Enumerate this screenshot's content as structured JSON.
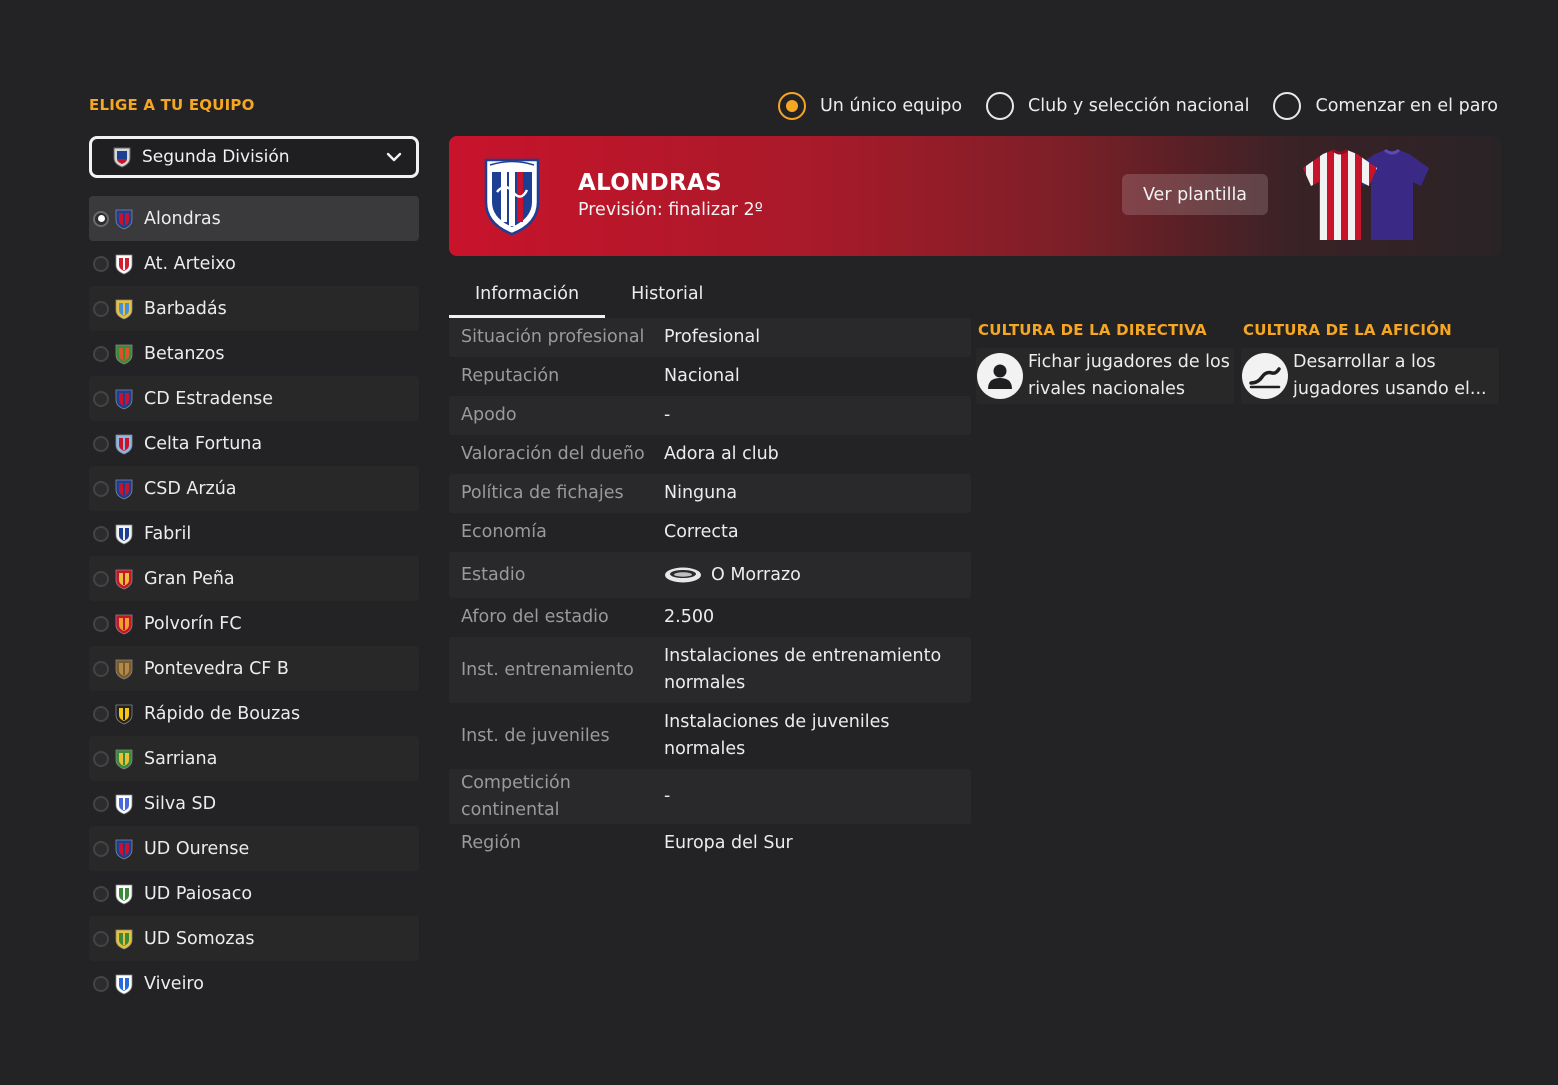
{
  "header": {
    "choose_team_title": "ELIGE A TU EQUIPO"
  },
  "division_select": {
    "value": "Segunda División"
  },
  "mode_options": [
    {
      "label": "Un único equipo",
      "selected": true
    },
    {
      "label": "Club y selección nacional",
      "selected": false
    },
    {
      "label": "Comenzar en el paro",
      "selected": false
    }
  ],
  "teams": [
    {
      "name": "Alondras",
      "selected": true,
      "colors": [
        "#c8132b",
        "#1c3f94"
      ]
    },
    {
      "name": "At. Arteixo",
      "selected": false,
      "colors": [
        "#d11f2e",
        "#ffffff"
      ]
    },
    {
      "name": "Barbadás",
      "selected": false,
      "colors": [
        "#4a90d9",
        "#e8c13a"
      ]
    },
    {
      "name": "Betanzos",
      "selected": false,
      "colors": [
        "#d9532b",
        "#3a8a3a"
      ]
    },
    {
      "name": "CD Estradense",
      "selected": false,
      "colors": [
        "#c8132b",
        "#1c3f94"
      ]
    },
    {
      "name": "Celta Fortuna",
      "selected": false,
      "colors": [
        "#c8132b",
        "#8ab8e0"
      ]
    },
    {
      "name": "CSD Arzúa",
      "selected": false,
      "colors": [
        "#c8132b",
        "#1c3f94"
      ]
    },
    {
      "name": "Fabril",
      "selected": false,
      "colors": [
        "#1c3f94",
        "#f2f2f2"
      ]
    },
    {
      "name": "Gran Peña",
      "selected": false,
      "colors": [
        "#e8c13a",
        "#c8132b"
      ]
    },
    {
      "name": "Polvorín FC",
      "selected": false,
      "colors": [
        "#f0a030",
        "#c8132b"
      ]
    },
    {
      "name": "Pontevedra CF B",
      "selected": false,
      "colors": [
        "#b08a4a",
        "#7a5a2a"
      ]
    },
    {
      "name": "Rápido de Bouzas",
      "selected": false,
      "colors": [
        "#f5c518",
        "#222222"
      ]
    },
    {
      "name": "Sarriana",
      "selected": false,
      "colors": [
        "#e8c13a",
        "#3a8a3a"
      ]
    },
    {
      "name": "Silva SD",
      "selected": false,
      "colors": [
        "#4a6ad9",
        "#ffffff"
      ]
    },
    {
      "name": "UD Ourense",
      "selected": false,
      "colors": [
        "#c8132b",
        "#1c3f94"
      ]
    },
    {
      "name": "UD Paiosaco",
      "selected": false,
      "colors": [
        "#3a8a3a",
        "#ffffff"
      ]
    },
    {
      "name": "UD Somozas",
      "selected": false,
      "colors": [
        "#3a8a3a",
        "#e8c13a"
      ]
    },
    {
      "name": "Viveiro",
      "selected": false,
      "colors": [
        "#2a6ad9",
        "#ffffff"
      ]
    }
  ],
  "banner": {
    "team_name": "ALONDRAS",
    "forecast": "Previsión: finalizar 2º",
    "squad_button": "Ver plantilla"
  },
  "tabs": [
    {
      "label": "Información",
      "active": true
    },
    {
      "label": "Historial",
      "active": false
    }
  ],
  "info": [
    {
      "key": "Situación profesional",
      "value": "Profesional"
    },
    {
      "key": "Reputación",
      "value": "Nacional"
    },
    {
      "key": "Apodo",
      "value": "-"
    },
    {
      "key": "Valoración del dueño",
      "value": "Adora al club"
    },
    {
      "key": "Política de fichajes",
      "value": "Ninguna"
    },
    {
      "key": "Economía",
      "value": "Correcta"
    },
    {
      "key": "Estadio",
      "value": "O Morrazo",
      "icon": "stadium-icon"
    },
    {
      "key": "Aforo del estadio",
      "value": "2.500"
    },
    {
      "key": "Inst. entrenamiento",
      "value": "Instalaciones de entrenamiento normales"
    },
    {
      "key": "Inst. de juveniles",
      "value": "Instalaciones de juveniles normales"
    },
    {
      "key": "Competición continental",
      "value": "-"
    },
    {
      "key": "Región",
      "value": "Europa del Sur"
    }
  ],
  "culture": {
    "board_title": "CULTURA DE LA DIRECTIVA",
    "board_text_1": "Fichar jugadores de los",
    "board_text_2": "rivales nacionales",
    "fans_title": "CULTURA DE LA AFICIÓN",
    "fans_text_1": "Desarrollar a los",
    "fans_text_2": "jugadores usando el..."
  },
  "colors": {
    "accent": "#f5a623",
    "banner_red": "#c8132b",
    "background": "#232325"
  }
}
